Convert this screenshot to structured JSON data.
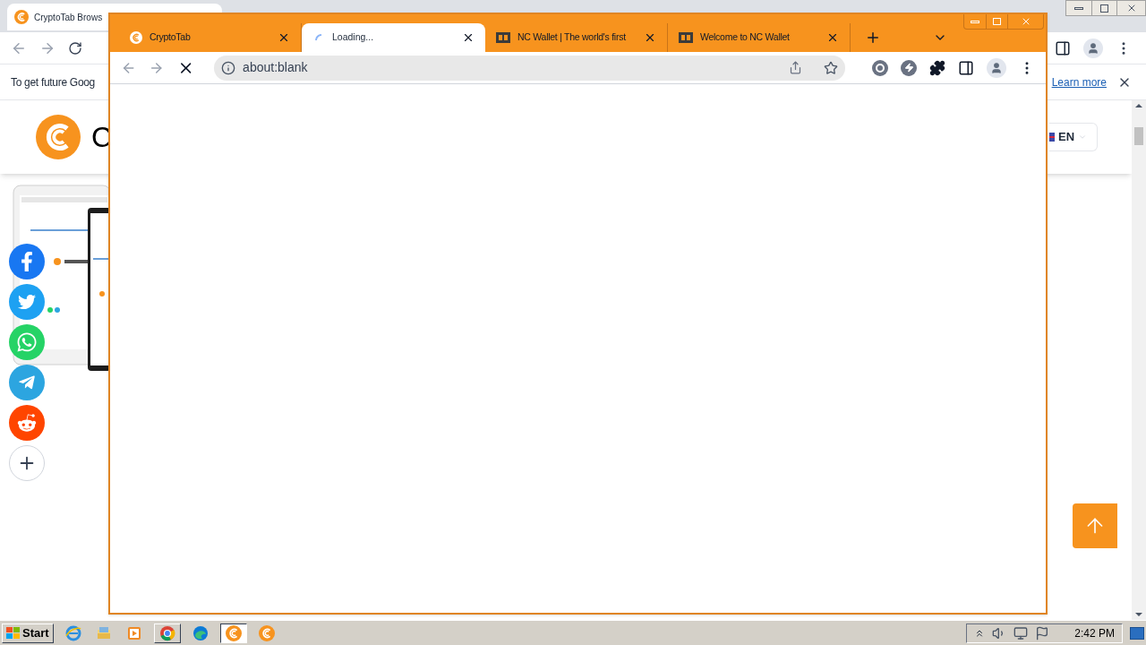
{
  "background_window": {
    "tab": {
      "title": "CryptoTab Brows"
    },
    "infobar": {
      "text": "To get future Goog",
      "link": "Learn more"
    },
    "header": {
      "logo_text": "C",
      "language": "EN"
    },
    "social_buttons": [
      {
        "kind": "facebook",
        "color": "#1877f2"
      },
      {
        "kind": "twitter",
        "color": "#1da1f2"
      },
      {
        "kind": "whatsapp",
        "color": "#25d366"
      },
      {
        "kind": "telegram",
        "color": "#2ca5e0"
      },
      {
        "kind": "reddit",
        "color": "#ff4500"
      },
      {
        "kind": "more",
        "color": "#ffffff"
      }
    ]
  },
  "foreground_window": {
    "tabs": [
      {
        "title": "CryptoTab",
        "kind": "cryptotab",
        "selected": false
      },
      {
        "title": "Loading...",
        "kind": "loading",
        "selected": true
      },
      {
        "title": "NC Wallet | The world's first",
        "kind": "nc",
        "selected": false
      },
      {
        "title": "Welcome to NC Wallet",
        "kind": "nc",
        "selected": false
      }
    ],
    "address": "about:blank",
    "loading": true
  },
  "taskbar": {
    "start": "Start",
    "items": [
      {
        "kind": "ie",
        "open": false,
        "selected": false
      },
      {
        "kind": "explorer",
        "open": false,
        "selected": false
      },
      {
        "kind": "media",
        "open": false,
        "selected": false
      },
      {
        "kind": "chrome",
        "open": true,
        "selected": false
      },
      {
        "kind": "edge",
        "open": false,
        "selected": false
      },
      {
        "kind": "cryptotab",
        "open": true,
        "selected": true
      },
      {
        "kind": "cryptotab",
        "open": false,
        "selected": false
      }
    ],
    "clock": "2:42 PM"
  }
}
